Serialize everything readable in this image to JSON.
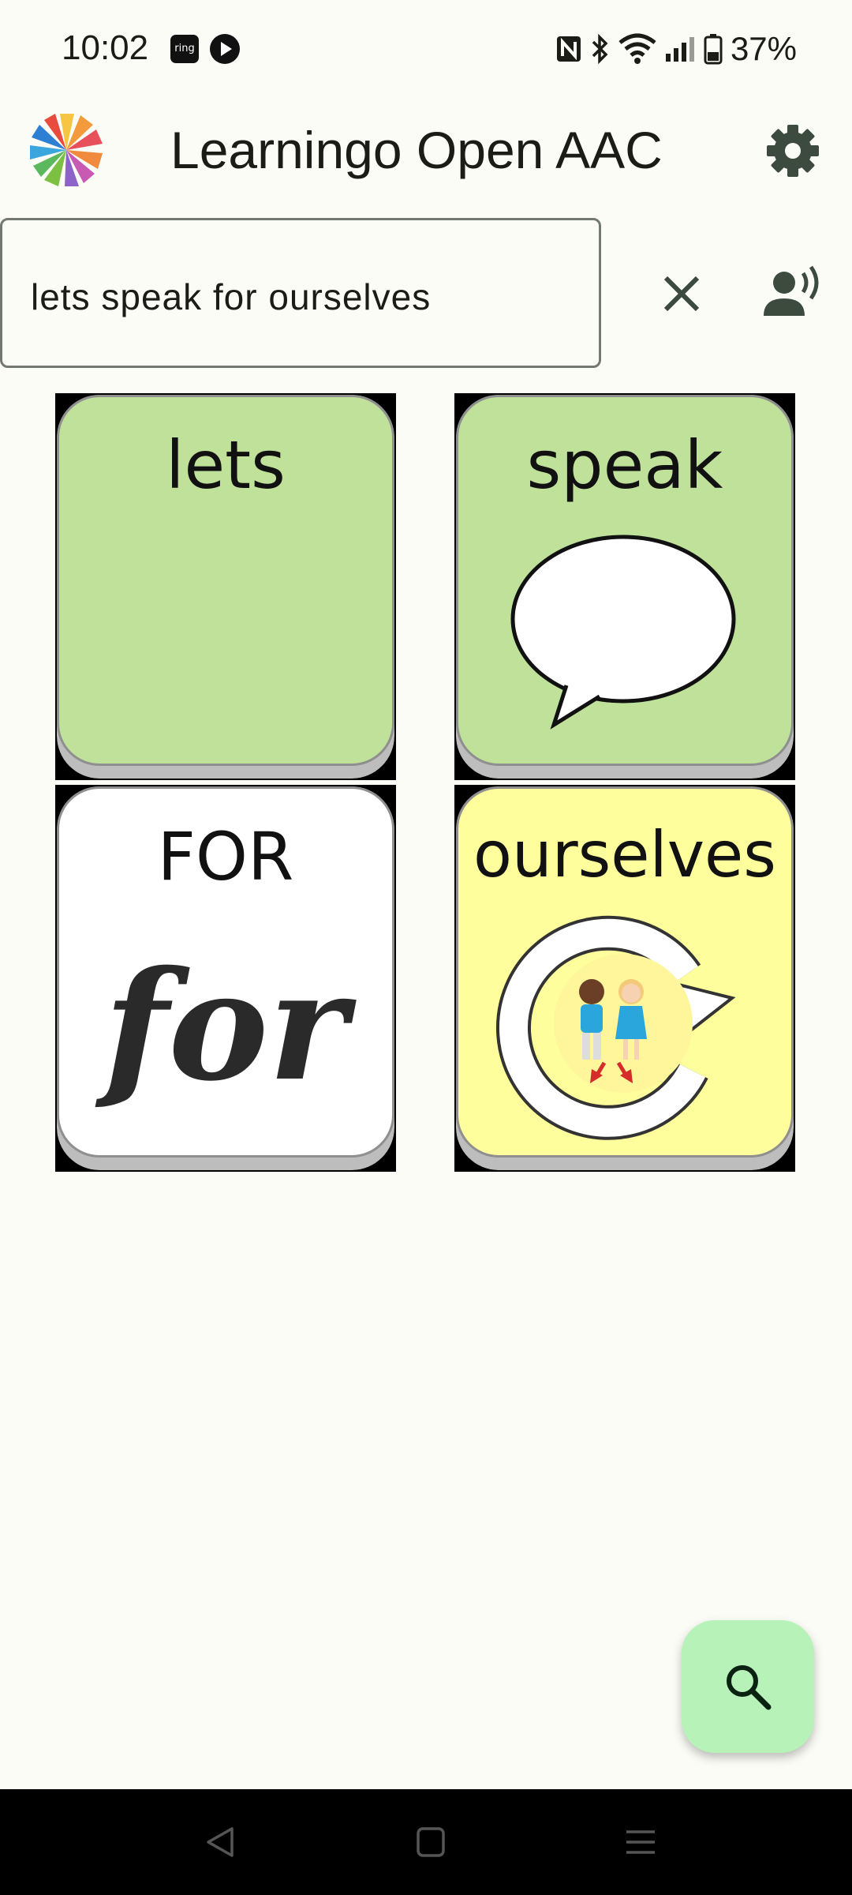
{
  "status_bar": {
    "time": "10:02",
    "ring_label": "ring",
    "battery_text": "37%"
  },
  "app_bar": {
    "title": "Learningo Open AAC"
  },
  "sentence": {
    "text": "lets speak for ourselves"
  },
  "tiles": [
    {
      "label": "lets",
      "color": "#bfe19a",
      "icon": "blank"
    },
    {
      "label": "speak",
      "color": "#bfe19a",
      "icon": "speech-bubble-icon"
    },
    {
      "label": "FOR",
      "color": "#ffffff",
      "icon": "for-word-icon",
      "art_text": "for"
    },
    {
      "label": "ourselves",
      "color": "#fffe9c",
      "icon": "ourselves-icon"
    }
  ],
  "colors": {
    "background": "#fbfcf6",
    "fab": "#b7f2b8",
    "tile_green": "#bfe19a",
    "tile_yellow": "#fffe9c"
  }
}
